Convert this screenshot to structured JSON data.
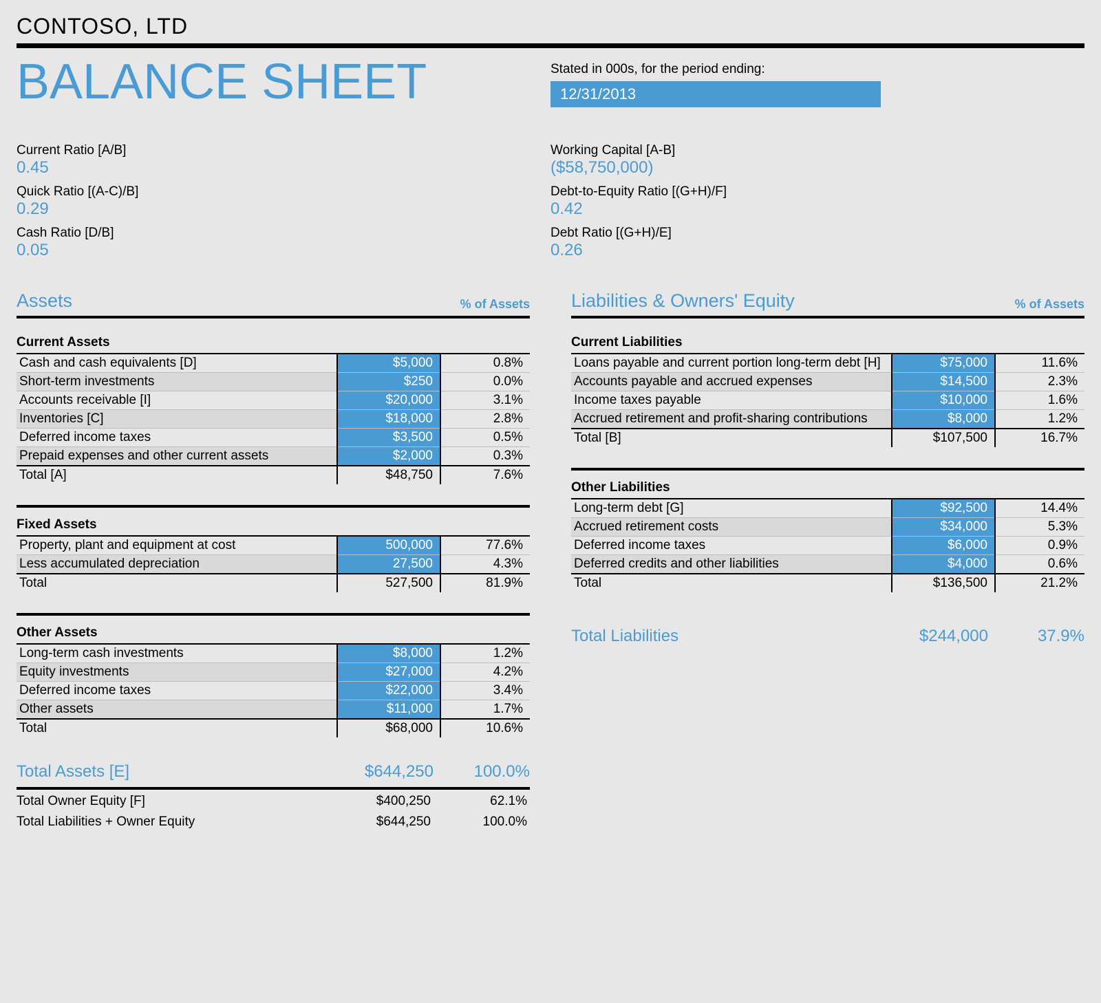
{
  "company": "CONTOSO, LTD",
  "title": "BALANCE SHEET",
  "period_label": "Stated in 000s, for the period ending:",
  "period_value": "12/31/2013",
  "ratios_left": [
    {
      "label": "Current Ratio   [A/B]",
      "value": "0.45"
    },
    {
      "label": "Quick Ratio   [(A-C)/B]",
      "value": "0.29"
    },
    {
      "label": "Cash Ratio   [D/B]",
      "value": "0.05"
    }
  ],
  "ratios_right": [
    {
      "label": "Working Capital   [A-B]",
      "value": "($58,750,000)"
    },
    {
      "label": "Debt-to-Equity Ratio   [(G+H)/F]",
      "value": "0.42"
    },
    {
      "label": "Debt Ratio   [(G+H)/E]",
      "value": "0.26"
    }
  ],
  "assets_header": {
    "title": "Assets",
    "pct": "% of Assets"
  },
  "liab_header": {
    "title": "Liabilities & Owners' Equity",
    "pct": "% of Assets"
  },
  "groups_left": [
    {
      "name": "Current Assets",
      "rows": [
        {
          "label": "Cash and cash equivalents   [D]",
          "amt": "$5,000",
          "pct": "0.8%"
        },
        {
          "label": "Short-term investments",
          "amt": "$250",
          "pct": "0.0%"
        },
        {
          "label": "Accounts receivable   [I]",
          "amt": "$20,000",
          "pct": "3.1%"
        },
        {
          "label": "Inventories   [C]",
          "amt": "$18,000",
          "pct": "2.8%"
        },
        {
          "label": "Deferred income taxes",
          "amt": "$3,500",
          "pct": "0.5%"
        },
        {
          "label": "Prepaid expenses and other current assets",
          "amt": "$2,000",
          "pct": "0.3%"
        }
      ],
      "total": {
        "label": "Total   [A]",
        "amt": "$48,750",
        "pct": "7.6%"
      }
    },
    {
      "name": "Fixed Assets",
      "rows": [
        {
          "label": "Property, plant and equipment at cost",
          "amt": "500,000",
          "pct": "77.6%"
        },
        {
          "label": "Less accumulated depreciation",
          "amt": "27,500",
          "pct": "4.3%"
        }
      ],
      "total": {
        "label": "Total",
        "amt": "527,500",
        "pct": "81.9%"
      }
    },
    {
      "name": "Other Assets",
      "rows": [
        {
          "label": "Long-term cash investments",
          "amt": "$8,000",
          "pct": "1.2%"
        },
        {
          "label": "Equity investments",
          "amt": "$27,000",
          "pct": "4.2%"
        },
        {
          "label": "Deferred income taxes",
          "amt": "$22,000",
          "pct": "3.4%"
        },
        {
          "label": "Other assets",
          "amt": "$11,000",
          "pct": "1.7%"
        }
      ],
      "total": {
        "label": "Total",
        "amt": "$68,000",
        "pct": "10.6%"
      }
    }
  ],
  "total_assets": {
    "label": "Total Assets   [E]",
    "amt": "$644,250",
    "pct": "100.0%"
  },
  "footer_left": [
    {
      "label": "Total Owner Equity   [F]",
      "amt": "$400,250",
      "pct": "62.1%"
    },
    {
      "label": "Total Liabilities + Owner Equity",
      "amt": "$644,250",
      "pct": "100.0%"
    }
  ],
  "groups_right": [
    {
      "name": "Current Liabilities",
      "rows": [
        {
          "label": "Loans payable and current portion long-term debt   [H]",
          "amt": "$75,000",
          "pct": "11.6%"
        },
        {
          "label": "Accounts payable and accrued expenses",
          "amt": "$14,500",
          "pct": "2.3%"
        },
        {
          "label": "Income taxes payable",
          "amt": "$10,000",
          "pct": "1.6%"
        },
        {
          "label": "Accrued retirement and profit-sharing contributions",
          "amt": "$8,000",
          "pct": "1.2%"
        }
      ],
      "total": {
        "label": "Total   [B]",
        "amt": "$107,500",
        "pct": "16.7%"
      }
    },
    {
      "name": "Other Liabilities",
      "rows": [
        {
          "label": "Long-term debt   [G]",
          "amt": "$92,500",
          "pct": "14.4%"
        },
        {
          "label": "Accrued retirement costs",
          "amt": "$34,000",
          "pct": "5.3%"
        },
        {
          "label": "Deferred income taxes",
          "amt": "$6,000",
          "pct": "0.9%"
        },
        {
          "label": "Deferred credits and other liabilities",
          "amt": "$4,000",
          "pct": "0.6%"
        }
      ],
      "total": {
        "label": "Total",
        "amt": "$136,500",
        "pct": "21.2%"
      }
    }
  ],
  "total_liab": {
    "label": "Total Liabilities",
    "amt": "$244,000",
    "pct": "37.9%"
  }
}
